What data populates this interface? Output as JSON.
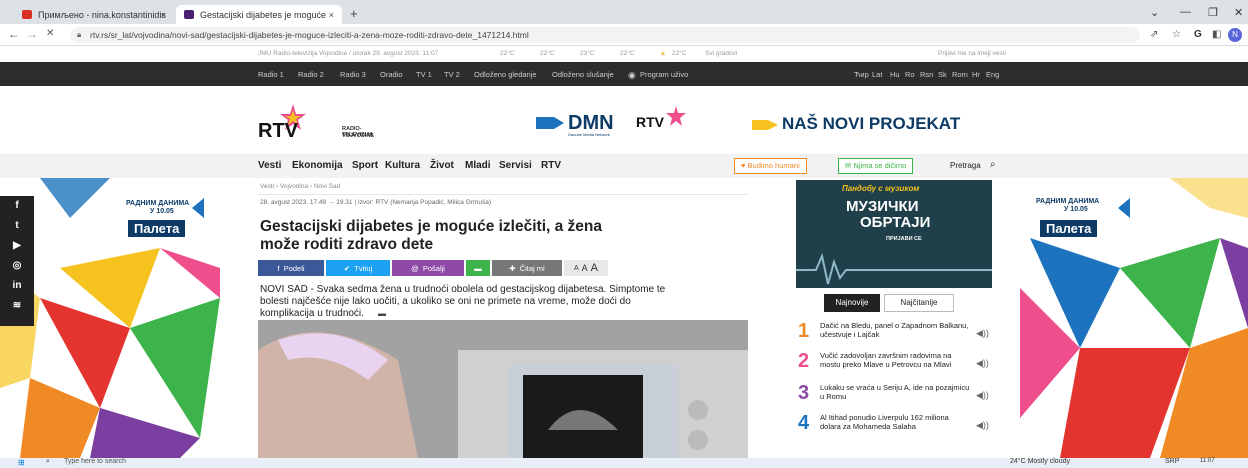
{
  "browser": {
    "tabs": [
      {
        "label": "Примљено - nina.konstantinidis",
        "favicon_color": "#d93025"
      },
      {
        "label": "Gestacijski dijabetes je moguće",
        "favicon_color": "#4b1f6f"
      }
    ],
    "new_tab": "+",
    "close_tab": "×",
    "url": "rtv.rs/sr_lat/vojvodina/novi-sad/gestacijski-dijabetes-je-moguce-izleciti-a-zena-moze-roditi-zdravo-dete_1471214.html",
    "back": "←",
    "forward": "→",
    "reload": "✕",
    "profile_initial": "N"
  },
  "infobar": {
    "date": "JMU Radio-televizija Vojvodine / utorak 29. avgust 2023. 11:07",
    "weather_link": "Svi gradovi",
    "newsletter": "Prijavi me na imejl vesti",
    "temps": [
      "22°C",
      "22°C",
      "23°C",
      "22°C",
      "22°C"
    ]
  },
  "nav1": {
    "items": [
      "Radio 1",
      "Radio 2",
      "Radio 3",
      "Oradio",
      "TV 1",
      "TV 2",
      "Odloženo gledanje",
      "Odloženo slušanje",
      "Program uživo"
    ],
    "langs": [
      "Ћир",
      "Lat",
      "Hu",
      "Ro",
      "Rsn",
      "Sk",
      "Rom",
      "Hr",
      "Eng"
    ]
  },
  "header": {
    "logo": "RTV",
    "logo_sub1": "RADIO-TELEVIZIJA",
    "logo_sub2": "VOJVODINE",
    "dmn": "DMN",
    "dmn_sub": "Danube Media Network",
    "promo": "NAŠ NOVI PROJEKAT"
  },
  "nav2": {
    "items": [
      "Vesti",
      "Ekonomija",
      "Sport",
      "Kultura",
      "Život",
      "Mladi",
      "Servisi",
      "RTV"
    ],
    "badge1": "Budimo humani",
    "badge2": "Njima se dičimo",
    "search": "Pretraga"
  },
  "ad": {
    "text1": "РАДНИМ ДАНИМА",
    "text2": "У 10.05",
    "brand": "Палета",
    "colors": {
      "yellow": "#f6c31e",
      "orange": "#f08a24",
      "red": "#e3342f",
      "pink": "#ef4e8c",
      "green": "#3db44b",
      "blue": "#1e73be",
      "purple": "#7a3fa0",
      "navy": "#0d3b66"
    }
  },
  "social": [
    "f",
    "t",
    "▶",
    "◎",
    "in",
    "≋"
  ],
  "article": {
    "breadcrumb": "Vesti › Vojvodina › Novi Sad",
    "meta": "28. avgust 2023. 17.49 → 19.31 | Izvor: RTV (Nemanja Popadić, Milica Grmuša)",
    "title_line1": "Gestacijski dijabetes je moguće izlečiti, a žena",
    "title_line2": "može roditi zdravo dete",
    "share": {
      "facebook": "Podeli",
      "twitter": "Tvituj",
      "email": "Pošalji",
      "read": "Čitaj mi",
      "font_a_small": "A",
      "font_a_mid": "A",
      "font_a_large": "A"
    },
    "lead_line1": "NOVI SAD - Svaka sedma žena u trudnoći obolela od gestacijskog dijabetesa. Simptome te",
    "lead_line2": "bolesti najčešće nije lako uočiti, a ukoliko se oni ne primete na vreme, može doći do",
    "lead_line3": "komplikacija u trudnoći."
  },
  "sidebar": {
    "banner_top": "Пандобу с музиком",
    "banner_main1": "МУЗИЧКИ",
    "banner_main2": "ОБРТАЈИ",
    "banner_sub": "ПРИЈАВИ СЕ",
    "tab_active": "Najnovije",
    "tab_inactive": "Najčitanije",
    "items": [
      {
        "num": "1",
        "text": "Dačić na Bledu, panel o Zapadnom Balkanu, učestvuje i Lajčak"
      },
      {
        "num": "2",
        "text": "Vučić zadovoljan završnim radovima na mostu preko Mlave u Petrovcu na Mlavi"
      },
      {
        "num": "3",
        "text": "Lukaku se vraća u Seriju A, ide na pozajmicu u Romu"
      },
      {
        "num": "4",
        "text": "Al Itihad ponudio Liverpulu 162 miliona dolara za Mohameda Salaha"
      }
    ]
  },
  "taskbar": {
    "search": "Type here to search",
    "weather": "24°C Mostly cloudy",
    "lang": "SRP",
    "time": "11:07",
    "date": "29/08/2023"
  }
}
